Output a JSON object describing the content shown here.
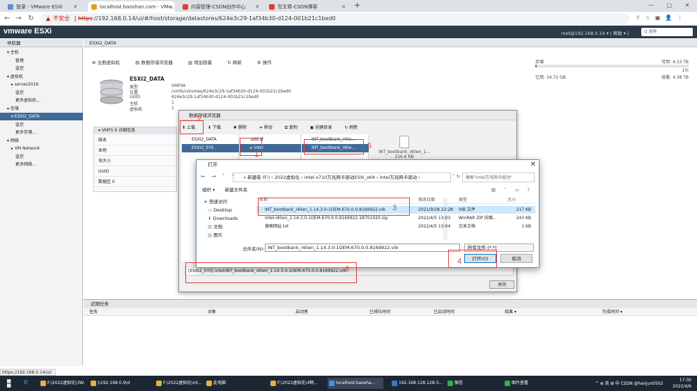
{
  "browser": {
    "tabs": [
      {
        "label": "登录 - VMware ESXi",
        "color": "#5c8fcc"
      },
      {
        "label": "localhost.baoshan.com - VMw...",
        "color": "#e3a21a"
      },
      {
        "label": "内容管理-CSDN创作中心",
        "color": "#e23b2e"
      },
      {
        "label": "写文章-CSDN博客",
        "color": "#e23b2e"
      }
    ],
    "new_tab": "+",
    "insecure_label": "不安全",
    "url_proto": "https",
    "url_rest": "://192.168.0.14/ui/#/host/storage/datastores/624e3c29-1af34b30-d124-001b21c1bed0"
  },
  "esxi": {
    "logo": "vmware ESXi",
    "user": "root@192.168.0.14 ▾ | 帮助 ▾ |",
    "search_placeholder": "Q 搜索"
  },
  "navigator": {
    "title": "导航器",
    "items": [
      {
        "label": "▾ 主机",
        "indent": 1,
        "selected": false
      },
      {
        "label": "管理",
        "indent": 3,
        "selected": false
      },
      {
        "label": "监控",
        "indent": 3,
        "selected": false
      },
      {
        "label": "▾ 虚拟机",
        "indent": 1,
        "selected": false
      },
      {
        "label": "▸ server2016",
        "indent": 2,
        "selected": false
      },
      {
        "label": "监控",
        "indent": 3,
        "selected": false
      },
      {
        "label": "更多虚拟机...",
        "indent": 3,
        "selected": false
      },
      {
        "label": "▾ 存储",
        "indent": 1,
        "selected": false
      },
      {
        "label": "▾ ESXI2_DATA",
        "indent": 2,
        "selected": true
      },
      {
        "label": "监控",
        "indent": 3,
        "selected": false
      },
      {
        "label": "更多存储...",
        "indent": 3,
        "selected": false
      },
      {
        "label": "▾ 网络",
        "indent": 1,
        "selected": false
      },
      {
        "label": "▸ VM Network",
        "indent": 2,
        "selected": false
      },
      {
        "label": "监控",
        "indent": 3,
        "selected": false
      },
      {
        "label": "更多网络...",
        "indent": 3,
        "selected": false
      }
    ]
  },
  "main": {
    "title": "ESXI2_DATA",
    "toolbar": [
      "注册虚拟机",
      "数据存储浏览器",
      "增加容量",
      "刷新",
      "操作"
    ],
    "ds_name": "ESXI2_DATA",
    "props": [
      {
        "k": "类型",
        "v": "VMFS6"
      },
      {
        "k": "位置",
        "v": "/vmfs/volumes/624e3c29-1af34b30-d124-001b21c1bed0"
      },
      {
        "k": "UUID",
        "v": "624e3c29-1af34b30-d124-001b21c1bed0"
      },
      {
        "k": "主机",
        "v": "1"
      },
      {
        "k": "虚拟机",
        "v": "1"
      }
    ],
    "storage": {
      "label": "存储",
      "free": "可用: 4.33 TB",
      "used_label": "已用: 34.72 GB",
      "capacity": "容量: 4.38 TB",
      "used_pct_text": "1%",
      "used_fraction": 0.01
    },
    "vmfs_title": "▾ VMFS 6 详细信息",
    "vmfs_rows": [
      "版本",
      "本地",
      "块大小",
      "UUID",
      "数据区 0"
    ]
  },
  "tasks": {
    "title": "近期任务",
    "cols": [
      "任务",
      "对象",
      "启动者",
      "已排队时间",
      "已启动时间",
      "结果 ▾",
      "完成时间 ▾"
    ]
  },
  "dsb": {
    "title": "数据存储浏览器",
    "toolbar": [
      "上载",
      "下载",
      "删除",
      "移动",
      "复制",
      "创建目录",
      "刷新"
    ],
    "col1": [
      "ESXI2_DATA",
      "ESXI2_SYS"
    ],
    "col2": [
      ".sdd.sf",
      "intel"
    ],
    "col3_header": "INT_bootbank_i40e...",
    "col3_selected": "INT_bootbank_i40e...",
    "preview_name": "INT_bootbank_i40en_1...",
    "preview_size": "216.6 KB",
    "path": "[ESXI2_SYS] intel/INT_bootbank_i40en_1.14.3.0-1OEM.670.0.0.8169922.vib",
    "close": "关闭"
  },
  "ofd": {
    "title": "打开",
    "breadcrumb": "« 新建卷 (F:) › 2022虚拟化 › intel x710万兆网卡驱动ESXi_x64 › intel万兆网卡驱动 ›",
    "search_placeholder": "搜索\"intel万兆网卡驱动\"",
    "organize": "组织 ▾",
    "new_folder": "新建文件夹",
    "left": [
      "快速访问",
      "Desktop",
      "Downloads",
      "文档",
      "图片"
    ],
    "headers": {
      "name": "名称",
      "date": "修改日期",
      "type": "类型",
      "size": "大小"
    },
    "files": [
      {
        "name": "INT_bootbank_i40en_1.14.3.0-1OEM.670.0.0.8169922.vib",
        "date": "2021/9/28 22:28",
        "type": "VIB 文件",
        "size": "217 KB"
      },
      {
        "name": "Intel-i40en_1.14.3.0-1OEM.670.0.0.8169922-18701020.zip",
        "date": "2022/4/5 13:03",
        "type": "WinRAR ZIP 压缩...",
        "size": "243 KB"
      },
      {
        "name": "搜索网址.txt",
        "date": "2022/4/5 13:04",
        "type": "文本文档",
        "size": "1 KB"
      }
    ],
    "filename_label": "文件名(N):",
    "filename_value": "INT_bootbank_i40en_1.14.3.0-1OEM.670.0.0.8169922.vib",
    "filetype": "所有文件 (*.*)",
    "open": "打开(O)",
    "cancel": "取消"
  },
  "annotations": [
    "1",
    "2",
    "3",
    "4",
    "5",
    "6"
  ],
  "status_url": "https://192.168.0.14/ui/",
  "taskbar": {
    "items": [
      {
        "label": "F:\\2022虚拟化\\3W...",
        "color": "#e8b339"
      },
      {
        "label": "\\\\192.168.0.9\\d",
        "color": "#e8b339"
      },
      {
        "label": "F:\\2022虚拟化\\int...",
        "color": "#e8b339"
      },
      {
        "label": "此电脑",
        "color": "#e8b339"
      },
      {
        "label": "F:\\2022虚拟化\\4物...",
        "color": "#e8b339"
      },
      {
        "label": "localhost.baosha...",
        "color": "#4c8bf5"
      },
      {
        "label": "192.168.128.128:3...",
        "color": "#3f78c5"
      },
      {
        "label": "微信",
        "color": "#2bb24c"
      },
      {
        "label": "图片查看",
        "color": "#2bb24c"
      }
    ],
    "time": "17:30",
    "date": "2022/4/6",
    "tray": "^ ⊕ 英 ⊞ 中 CSDN @hanjun0502"
  }
}
